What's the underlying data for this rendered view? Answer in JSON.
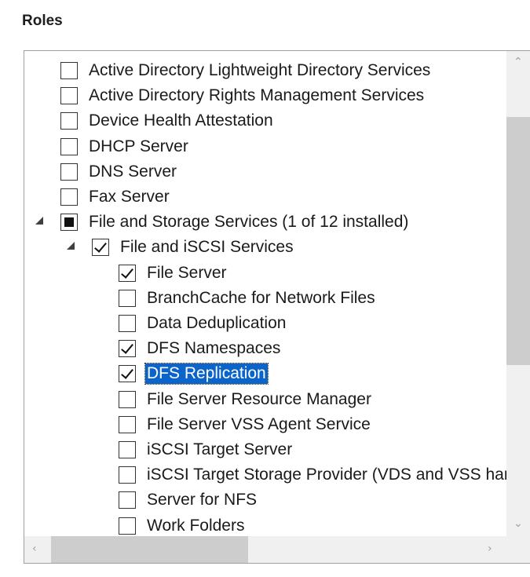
{
  "heading": "Roles",
  "roles": [
    {
      "label": "Active Directory Lightweight Directory Services",
      "state": "unchecked",
      "level": 0
    },
    {
      "label": "Active Directory Rights Management Services",
      "state": "unchecked",
      "level": 0
    },
    {
      "label": "Device Health Attestation",
      "state": "unchecked",
      "level": 0
    },
    {
      "label": "DHCP Server",
      "state": "unchecked",
      "level": 0
    },
    {
      "label": "DNS Server",
      "state": "unchecked",
      "level": 0
    },
    {
      "label": "Fax Server",
      "state": "unchecked",
      "level": 0
    },
    {
      "label": "File and Storage Services (1 of 12 installed)",
      "state": "partial",
      "level": 0,
      "expanded": true
    },
    {
      "label": "File and iSCSI Services",
      "state": "checked",
      "level": 1,
      "expanded": true
    },
    {
      "label": "File Server",
      "state": "checked",
      "level": 2
    },
    {
      "label": "BranchCache for Network Files",
      "state": "unchecked",
      "level": 2
    },
    {
      "label": "Data Deduplication",
      "state": "unchecked",
      "level": 2
    },
    {
      "label": "DFS Namespaces",
      "state": "checked",
      "level": 2
    },
    {
      "label": "DFS Replication",
      "state": "checked",
      "level": 2,
      "selected": true
    },
    {
      "label": "File Server Resource Manager",
      "state": "unchecked",
      "level": 2
    },
    {
      "label": "File Server VSS Agent Service",
      "state": "unchecked",
      "level": 2
    },
    {
      "label": "iSCSI Target Server",
      "state": "unchecked",
      "level": 2
    },
    {
      "label": "iSCSI Target Storage Provider (VDS and VSS hardware providers)",
      "state": "unchecked",
      "level": 2
    },
    {
      "label": "Server for NFS",
      "state": "unchecked",
      "level": 2
    },
    {
      "label": "Work Folders",
      "state": "unchecked",
      "level": 2
    }
  ],
  "scrollbar": {
    "up_arrow": "⌃",
    "down_arrow": "⌄",
    "left_arrow": "‹",
    "right_arrow": "›"
  }
}
